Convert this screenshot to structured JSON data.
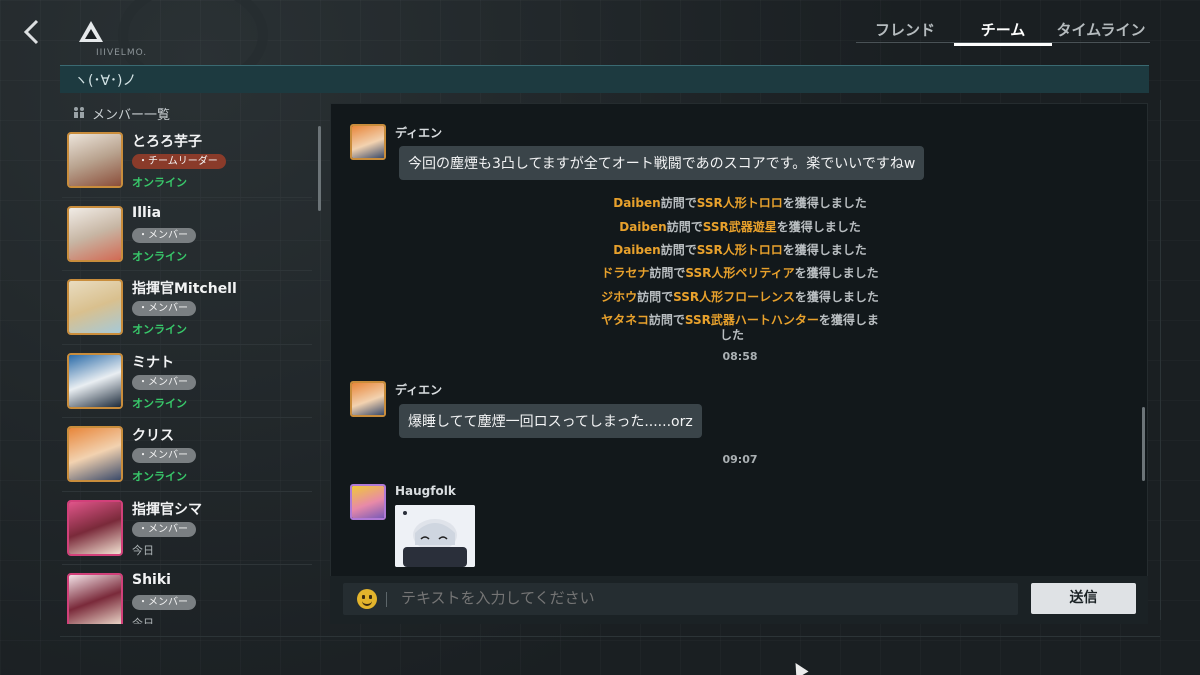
{
  "header": {
    "back_icon": "chevron-left-icon",
    "brand_text": "IIIVELMO.",
    "tabs": [
      {
        "label": "フレンド",
        "active": false
      },
      {
        "label": "チーム",
        "active": true
      },
      {
        "label": "タイムライン",
        "active": false
      }
    ]
  },
  "status_bar": {
    "text": "ヽ(･∀･)ノ"
  },
  "members": {
    "title": "メンバー一覧",
    "items": [
      {
        "name": "とろろ芋子",
        "role": "・チームリーダー",
        "status": "オンライン",
        "online": true,
        "leader": true
      },
      {
        "name": "Illia",
        "role": "・メンバー",
        "status": "オンライン",
        "online": true,
        "leader": false
      },
      {
        "name": "指揮官Mitchell",
        "role": "・メンバー",
        "status": "オンライン",
        "online": true,
        "leader": false
      },
      {
        "name": "ミナト",
        "role": "・メンバー",
        "status": "オンライン",
        "online": true,
        "leader": false
      },
      {
        "name": "クリス",
        "role": "・メンバー",
        "status": "オンライン",
        "online": true,
        "leader": false
      },
      {
        "name": "指揮官シマ",
        "role": "・メンバー",
        "status": "今日",
        "online": false,
        "leader": false
      },
      {
        "name": "Shiki",
        "role": "・メンバー",
        "status": "今日",
        "online": false,
        "leader": false
      }
    ]
  },
  "chat": {
    "messages": [
      {
        "sender": "ディエン",
        "text": "今回の塵煙も3凸してますが全てオート戦闘であのスコアです。楽でいいですねw"
      },
      {
        "sender": "ディエン",
        "text": "爆睡してて塵煙一回ロスってしまった......orz"
      },
      {
        "sender": "Haugfolk",
        "text": ""
      }
    ],
    "system": [
      {
        "name": "Daiben",
        "mid": "訪問で",
        "item": "SSR人形トロロ",
        "tail": "を獲得しました"
      },
      {
        "name": "Daiben",
        "mid": "訪問で",
        "item": "SSR武器遊星",
        "tail": "を獲得しました"
      },
      {
        "name": "Daiben",
        "mid": "訪問で",
        "item": "SSR人形トロロ",
        "tail": "を獲得しました"
      },
      {
        "name": "ドラセナ",
        "mid": "訪問で",
        "item": "SSR人形ペリティア",
        "tail": "を獲得しました"
      },
      {
        "name": "ジホウ",
        "mid": "訪問で",
        "item": "SSR人形フローレンス",
        "tail": "を獲得しました"
      },
      {
        "name": "ヤタネコ",
        "mid": "訪問で",
        "item": "SSR武器ハートハンター",
        "tail": "を獲得しま",
        "tail2": "した"
      }
    ],
    "timestamps": [
      "08:58",
      "09:07"
    ]
  },
  "input": {
    "placeholder": "テキストを入力してください",
    "emoji_icon": "smiley-icon",
    "send_label": "送信"
  },
  "colors": {
    "accent_orange": "#e8a12c",
    "online_green": "#38c86a",
    "leader_badge": "#8a3b2a"
  }
}
